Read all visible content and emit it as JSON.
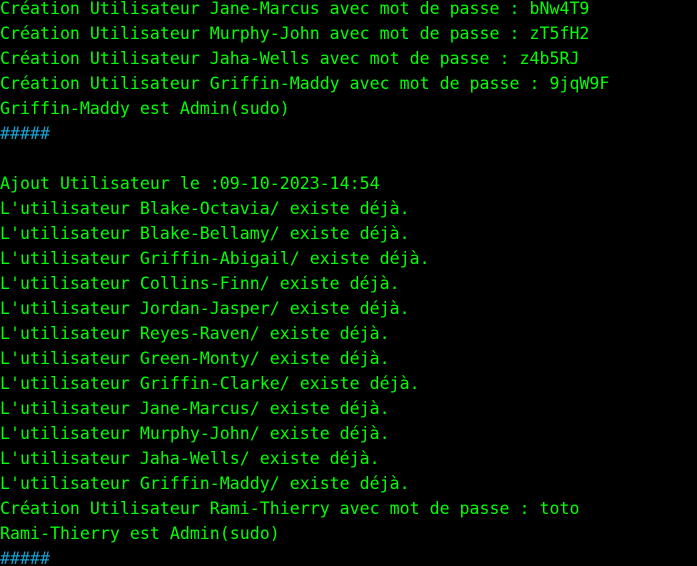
{
  "terminal": {
    "colors": {
      "background": "#000000",
      "text": "#00ff00",
      "separator": "#17a0d0"
    },
    "lines": [
      "Création Utilisateur Jane-Marcus avec mot de passe : bNw4T9",
      "Création Utilisateur Murphy-John avec mot de passe : zT5fH2",
      "Création Utilisateur Jaha-Wells avec mot de passe : z4b5RJ",
      "Création Utilisateur Griffin-Maddy avec mot de passe : 9jqW9F",
      "Griffin-Maddy est Admin(sudo)",
      "#####",
      "",
      "Ajout Utilisateur le :09-10-2023-14:54",
      "L'utilisateur Blake-Octavia/ existe déjà.",
      "L'utilisateur Blake-Bellamy/ existe déjà.",
      "L'utilisateur Griffin-Abigail/ existe déjà.",
      "L'utilisateur Collins-Finn/ existe déjà.",
      "L'utilisateur Jordan-Jasper/ existe déjà.",
      "L'utilisateur Reyes-Raven/ existe déjà.",
      "L'utilisateur Green-Monty/ existe déjà.",
      "L'utilisateur Griffin-Clarke/ existe déjà.",
      "L'utilisateur Jane-Marcus/ existe déjà.",
      "L'utilisateur Murphy-John/ existe déjà.",
      "L'utilisateur Jaha-Wells/ existe déjà.",
      "L'utilisateur Griffin-Maddy/ existe déjà.",
      "Création Utilisateur Rami-Thierry avec mot de passe : toto",
      "Rami-Thierry est Admin(sudo)",
      "#####"
    ]
  }
}
